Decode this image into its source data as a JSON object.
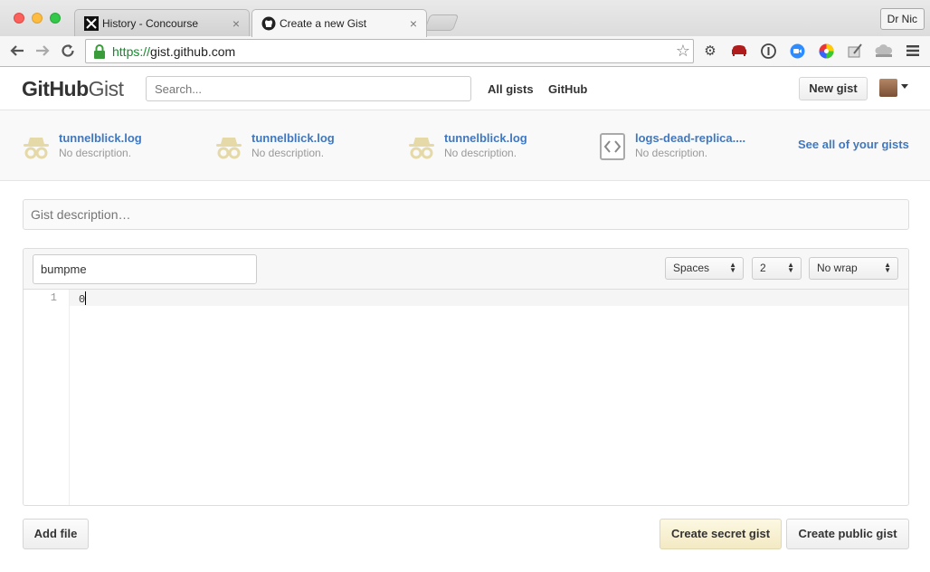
{
  "browser": {
    "tabs": [
      {
        "title": "History - Concourse",
        "icon": "concourse-plane-icon",
        "active": false
      },
      {
        "title": "Create a new Gist",
        "icon": "github-octocat-icon",
        "active": true
      }
    ],
    "close_glyph": "×",
    "profile_name": "Dr Nic",
    "url_secure": "https://",
    "url_rest": "gist.github.com"
  },
  "header": {
    "logo_strong": "GitHub",
    "logo_light": "Gist",
    "search_placeholder": "Search...",
    "nav": [
      "All gists",
      "GitHub"
    ],
    "new_gist": "New gist"
  },
  "recent_gists": [
    {
      "name": "tunnelblick.log",
      "description": "No description.",
      "icon": "secret-gist-icon"
    },
    {
      "name": "tunnelblick.log",
      "description": "No description.",
      "icon": "secret-gist-icon"
    },
    {
      "name": "tunnelblick.log",
      "description": "No description.",
      "icon": "secret-gist-icon"
    },
    {
      "name": "logs-dead-replica....",
      "description": "No description.",
      "icon": "code-file-icon"
    }
  ],
  "see_all": "See all of your gists",
  "editor": {
    "description_placeholder": "Gist description…",
    "filename": "bumpme",
    "indent_mode": "Spaces",
    "indent_size": "2",
    "wrap_mode": "No wrap",
    "line_number": "1",
    "code": "0"
  },
  "actions": {
    "add_file": "Add file",
    "create_secret": "Create secret gist",
    "create_public": "Create public gist"
  },
  "colors": {
    "link": "#4078c0",
    "secure_url": "#128a2a",
    "secret_button": "#fcf8e3"
  }
}
